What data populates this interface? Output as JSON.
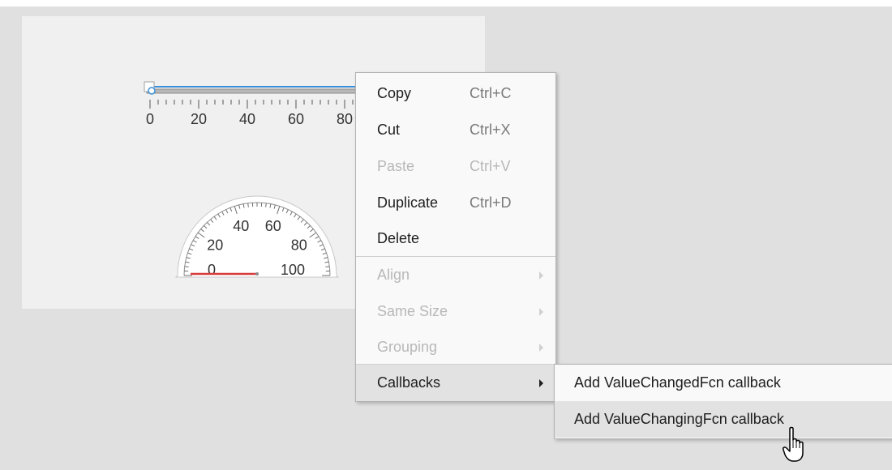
{
  "slider": {
    "ticks": [
      "0",
      "20",
      "40",
      "60",
      "80"
    ],
    "value": 0
  },
  "gauge": {
    "ticks": [
      "0",
      "20",
      "40",
      "60",
      "80",
      "100"
    ],
    "value": 0,
    "needle_color": "#d83b3b"
  },
  "context_menu": {
    "items": [
      {
        "label": "Copy",
        "shortcut": "Ctrl+C",
        "enabled": true
      },
      {
        "label": "Cut",
        "shortcut": "Ctrl+X",
        "enabled": true
      },
      {
        "label": "Paste",
        "shortcut": "Ctrl+V",
        "enabled": false
      },
      {
        "label": "Duplicate",
        "shortcut": "Ctrl+D",
        "enabled": true
      },
      {
        "label": "Delete",
        "shortcut": "",
        "enabled": true
      },
      {
        "label": "Align",
        "shortcut": "",
        "enabled": false,
        "submenu": true
      },
      {
        "label": "Same Size",
        "shortcut": "",
        "enabled": false,
        "submenu": true
      },
      {
        "label": "Grouping",
        "shortcut": "",
        "enabled": false,
        "submenu": true
      },
      {
        "label": "Callbacks",
        "shortcut": "",
        "enabled": true,
        "submenu": true,
        "active": true
      }
    ]
  },
  "callbacks_submenu": {
    "items": [
      {
        "label": "Add ValueChangedFcn callback"
      },
      {
        "label": "Add ValueChangingFcn callback",
        "hover": true
      }
    ]
  },
  "colors": {
    "selection_blue": "#3b8fd8",
    "menu_bg": "#f9f9f9",
    "canvas_bg": "#f0f0f0",
    "workspace_bg": "#e0e0e0"
  }
}
